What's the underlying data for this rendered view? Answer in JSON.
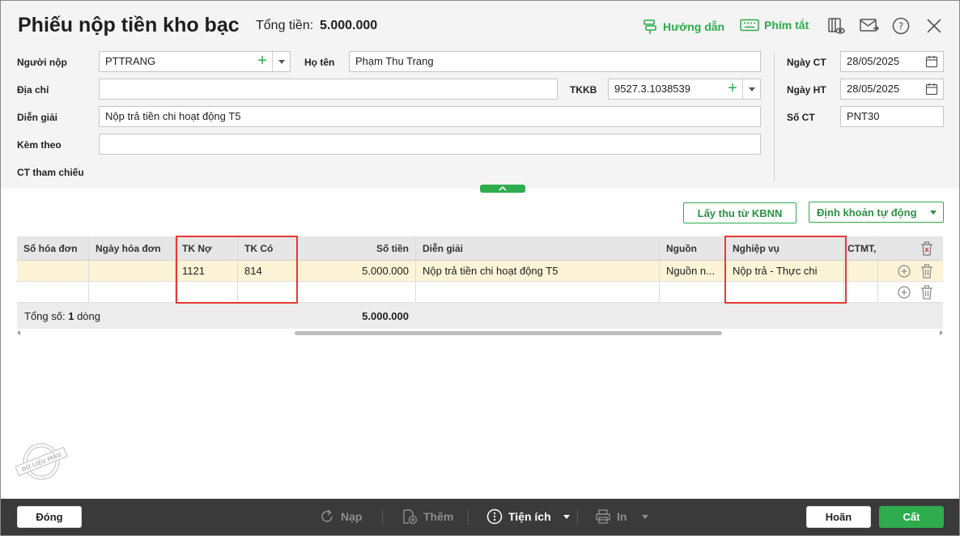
{
  "window": {
    "title": "Phiếu nộp tiền kho bạc",
    "total_label": "Tổng tiền:",
    "total_value": "5.000.000"
  },
  "toolbar": {
    "guide_label": "Hướng dẫn",
    "shortcut_label": "Phím tắt"
  },
  "form": {
    "payer_label": "Người nộp",
    "payer_value": "PTTRANG",
    "fullname_label": "Họ tên",
    "fullname_value": "Phạm Thu Trang",
    "address_label": "Địa chỉ",
    "address_value": "",
    "tkkb_label": "TKKB",
    "tkkb_value": "9527.3.1038539",
    "description_label": "Diễn giải",
    "description_value": "Nộp trả tiền chi hoạt động T5",
    "attach_label": "Kèm theo",
    "attach_value": "",
    "ref_label": "CT tham chiếu",
    "ngay_ct_label": "Ngày CT",
    "ngay_ct_value": "28/05/2025",
    "ngay_ht_label": "Ngày HT",
    "ngay_ht_value": "28/05/2025",
    "so_ct_label": "Số CT",
    "so_ct_value": "PNT30"
  },
  "actions": {
    "kbnn_label": "Lấy thu từ KBNN",
    "auto_label": "Định khoản tự động"
  },
  "grid": {
    "headers": [
      "Số hóa đơn",
      "Ngày hóa đơn",
      "TK Nợ",
      "TK Có",
      "Số tiền",
      "Diễn giải",
      "Nguồn",
      "Nghiệp vụ",
      "CTMT,"
    ],
    "rows": [
      {
        "invoice_no": "",
        "invoice_date": "",
        "debit": "1121",
        "credit": "814",
        "amount": "5.000.000",
        "desc": "Nộp trả tiền chi hoạt động T5",
        "source": "Nguồn n...",
        "operation": "Nộp trả - Thực chi",
        "ctmt": ""
      }
    ],
    "summary_prefix": "Tổng số:",
    "summary_count": "1",
    "summary_suffix": "dòng",
    "summary_amount": "5.000.000"
  },
  "stamp_text": "DỮ LIỆU MẪU",
  "footer": {
    "close_label": "Đóng",
    "reload_label": "Nạp",
    "add_label": "Thêm",
    "utility_label": "Tiện ích",
    "print_label": "In",
    "cancel_label": "Hoãn",
    "save_label": "Cất"
  },
  "colors": {
    "accent": "#2eac4e",
    "highlight_row": "#fdf3d6",
    "annotation": "#e53935",
    "footer_bg": "#3a3a3a"
  }
}
